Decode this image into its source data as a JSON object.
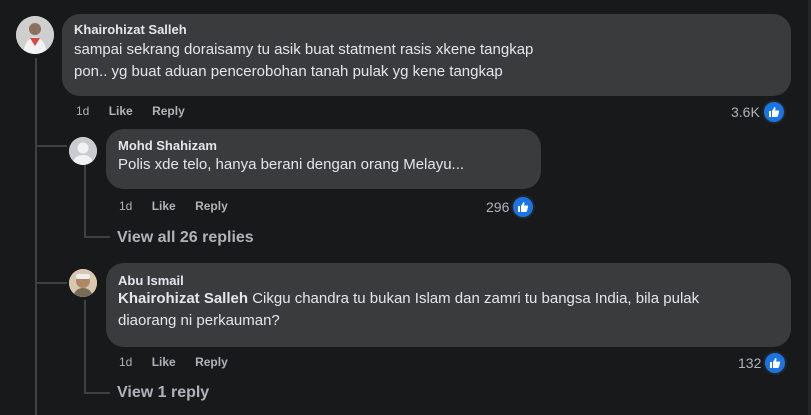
{
  "comments": [
    {
      "author": "Khairohizat Salleh",
      "text": "sampai sekrang doraisamy tu asik buat statment rasis xkene tangkap pon.. yg buat aduan pencerobohan tanah pulak yg kene tangkap",
      "time": "1d",
      "like_label": "Like",
      "reply_label": "Reply",
      "reaction_count": "3.6K"
    },
    {
      "author": "Mohd Shahizam",
      "text": "Polis xde telo, hanya berani dengan orang Melayu...",
      "time": "1d",
      "like_label": "Like",
      "reply_label": "Reply",
      "reaction_count": "296",
      "view_replies": "View all 26 replies"
    },
    {
      "author": "Abu Ismail",
      "mention": "Khairohizat Salleh",
      "text": " Cikgu chandra tu bukan Islam dan zamri tu bangsa India, bila pulak diaorang ni perkauman?",
      "time": "1d",
      "like_label": "Like",
      "reply_label": "Reply",
      "reaction_count": "132",
      "view_replies": "View 1 reply"
    }
  ],
  "colors": {
    "background": "#18191a",
    "bubble": "#3a3b3c",
    "like_blue": "#1b74e4",
    "secondary_text": "#b0b3b8"
  }
}
